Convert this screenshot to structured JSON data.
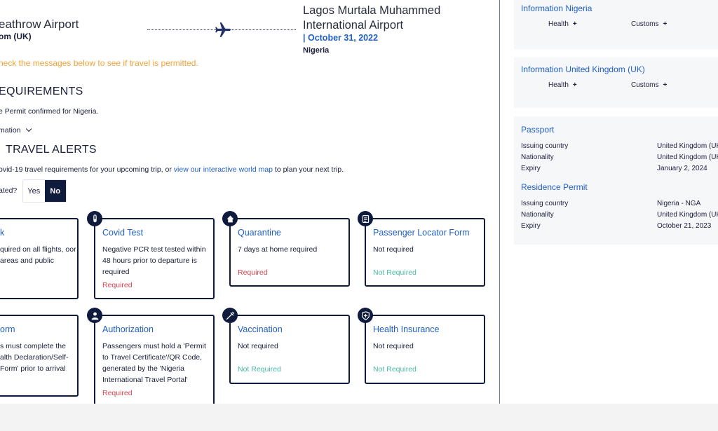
{
  "trip": {
    "origin_name": "eathrow Airport",
    "origin_country": "om (UK)",
    "destination_name": "Lagos Murtala Muhammed International Airport",
    "destination_date": "| October 31, 2022",
    "destination_country": "Nigeria"
  },
  "notice": "heck the messages below to see if travel is permitted.",
  "requirements": {
    "title": "EQUIREMENTS",
    "permit_text": "e Permit confirmed for Nigeria.",
    "more_info": "mation"
  },
  "alerts": {
    "title": "TRAVEL ALERTS",
    "intro_before": "ovid-19 travel requirements for your upcoming trip, or ",
    "intro_link": "view our interactive world map",
    "intro_after": " to plan your next trip.",
    "question": "ated?",
    "toggle_yes": "Yes",
    "toggle_no": "No"
  },
  "cards": [
    {
      "title": "k",
      "desc": "quired on all flights, oor areas and public",
      "status": ""
    },
    {
      "title": "Covid Test",
      "desc": "Negative PCR test tested within 48 hours prior to departure is required",
      "status": "Required"
    },
    {
      "title": "Quarantine",
      "desc": "7 days at home required",
      "status": "Required"
    },
    {
      "title": "Passenger Locator Form",
      "desc": "Not required",
      "status": "Not Required"
    },
    {
      "title": "orm",
      "desc": "s must complete the alth Declaration/Self-Form' prior to arrival",
      "status": ""
    },
    {
      "title": "Authorization",
      "desc": "Passengers must hold a 'Permit to Travel Certificate'/QR Code, generated by the 'Nigeria International Travel Portal'",
      "status": "Required"
    },
    {
      "title": "Vaccination",
      "desc": "Not required",
      "status": "Not Required"
    },
    {
      "title": "Health Insurance",
      "desc": "Not required",
      "status": "Not Required"
    }
  ],
  "side": {
    "info_nigeria": {
      "title": "Information Nigeria",
      "health": "Health",
      "customs": "Customs",
      "plus": "+"
    },
    "info_uk": {
      "title": "Information United Kingdom (UK)",
      "health": "Health",
      "customs": "Customs",
      "plus": "+"
    },
    "passport": {
      "title": "Passport",
      "rows": [
        {
          "label": "Issuing country",
          "value": "United Kingdom (UK"
        },
        {
          "label": "Nationality",
          "value": "United Kingdom (UK"
        },
        {
          "label": "Expiry",
          "value": "January 2, 2024"
        }
      ]
    },
    "residence": {
      "title": "Residence Permit",
      "rows": [
        {
          "label": "Issuing country",
          "value": "Nigeria - NGA"
        },
        {
          "label": "Nationality",
          "value": "United Kingdom (UK"
        },
        {
          "label": "Expiry",
          "value": "October 21, 2023"
        }
      ]
    }
  },
  "colors": {
    "accent": "#1f5fc7",
    "navy": "#0f1b3d",
    "required": "#d9434f",
    "not_required": "#48b9a6",
    "notice": "#f0a23a"
  }
}
